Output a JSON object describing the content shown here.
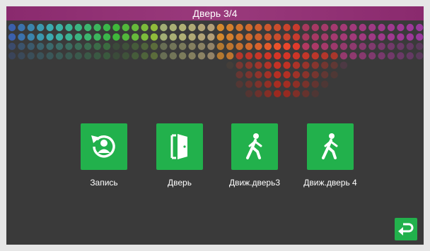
{
  "header": {
    "title": "Дверь 3/4"
  },
  "tiles": [
    {
      "label": "Запись",
      "icon": "record-user-icon"
    },
    {
      "label": "Дверь",
      "icon": "door-icon"
    },
    {
      "label": "Движ.дверь3",
      "icon": "walking-person-icon"
    },
    {
      "label": "Движ.дверь 4",
      "icon": "walking-person-icon"
    }
  ],
  "back_button": {
    "icon": "return-arrow-icon"
  },
  "colors": {
    "title_bar": "#8a2a6e",
    "tile_green": "#22b14c",
    "background": "#3a3a3a",
    "frame": "#e6e6e6"
  },
  "wallpaper": {
    "pattern": "color-dot-palette",
    "icon": "dot-grid"
  }
}
